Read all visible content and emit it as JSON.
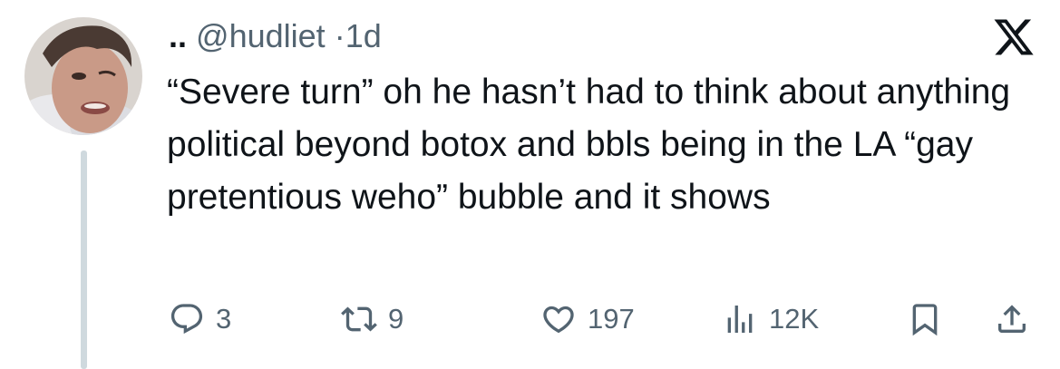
{
  "tweet": {
    "display_name": "..",
    "handle": "@hudliet",
    "separator": "·",
    "time": "1d",
    "text": "“Severe turn” oh he hasn’t had to think about anything political beyond botox and bbls being in the LA “gay pretentious weho” bubble and it shows"
  },
  "actions": {
    "reply_count": "3",
    "retweet_count": "9",
    "like_count": "197",
    "views_count": "12K"
  },
  "icons": {
    "platform": "x-logo-icon",
    "reply": "reply-icon",
    "retweet": "retweet-icon",
    "like": "heart-icon",
    "views": "views-icon",
    "bookmark": "bookmark-icon",
    "share": "share-icon"
  },
  "colors": {
    "text": "#0f1419",
    "secondary": "#536471",
    "thread_line": "#cfd9de"
  }
}
